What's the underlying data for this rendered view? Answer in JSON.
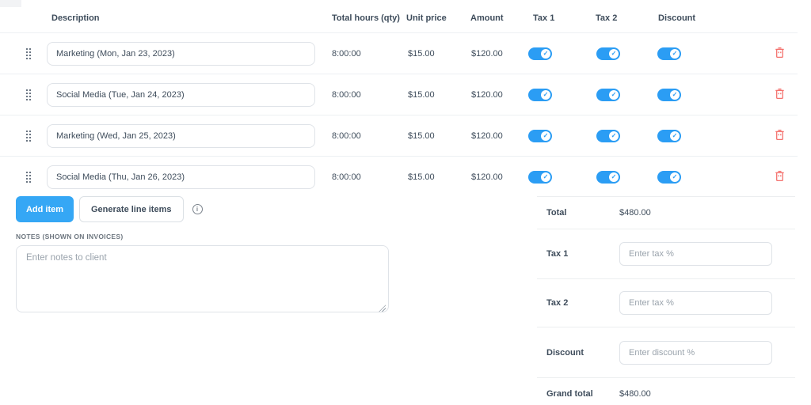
{
  "colors": {
    "accent_blue": "#35a7f5",
    "toggle_blue": "#2b9df4",
    "danger_red": "#f4716d",
    "text_dark": "#3e4c5b",
    "divider": "#edf0f3"
  },
  "icons": {
    "info": "i",
    "check": "✓",
    "drag": "drag-dots",
    "trash": "trash-outline"
  },
  "table": {
    "columns": [
      "Description",
      "Total hours (qty)",
      "Unit price",
      "Amount",
      "Tax 1",
      "Tax 2",
      "Discount"
    ],
    "rows": [
      {
        "description": "Marketing (Mon, Jan 23, 2023)",
        "hours": "8:00:00",
        "unit_price": "$15.00",
        "amount": "$120.00",
        "tax_1_on": true,
        "tax_2_on": true,
        "discount_on": true
      },
      {
        "description": "Social Media (Tue, Jan 24, 2023)",
        "hours": "8:00:00",
        "unit_price": "$15.00",
        "amount": "$120.00",
        "tax_1_on": true,
        "tax_2_on": true,
        "discount_on": true
      },
      {
        "description": "Marketing (Wed, Jan 25, 2023)",
        "hours": "8:00:00",
        "unit_price": "$15.00",
        "amount": "$120.00",
        "tax_1_on": true,
        "tax_2_on": true,
        "discount_on": true
      },
      {
        "description": "Social Media (Thu, Jan 26, 2023)",
        "hours": "8:00:00",
        "unit_price": "$15.00",
        "amount": "$120.00",
        "tax_1_on": true,
        "tax_2_on": true,
        "discount_on": true
      }
    ]
  },
  "actions": {
    "add_item_label": "Add item",
    "generate_label": "Generate line items"
  },
  "notes": {
    "label": "NOTES (SHOWN ON INVOICES)",
    "placeholder": "Enter notes to client",
    "value": ""
  },
  "summary": {
    "rows": [
      {
        "label": "Total",
        "value": "$480.00"
      },
      {
        "label": "Tax 1",
        "placeholder": "Enter tax %"
      },
      {
        "label": "Tax 2",
        "placeholder": "Enter tax %"
      },
      {
        "label": "Discount",
        "placeholder": "Enter discount %"
      },
      {
        "label": "Grand total",
        "value": "$480.00"
      }
    ]
  }
}
